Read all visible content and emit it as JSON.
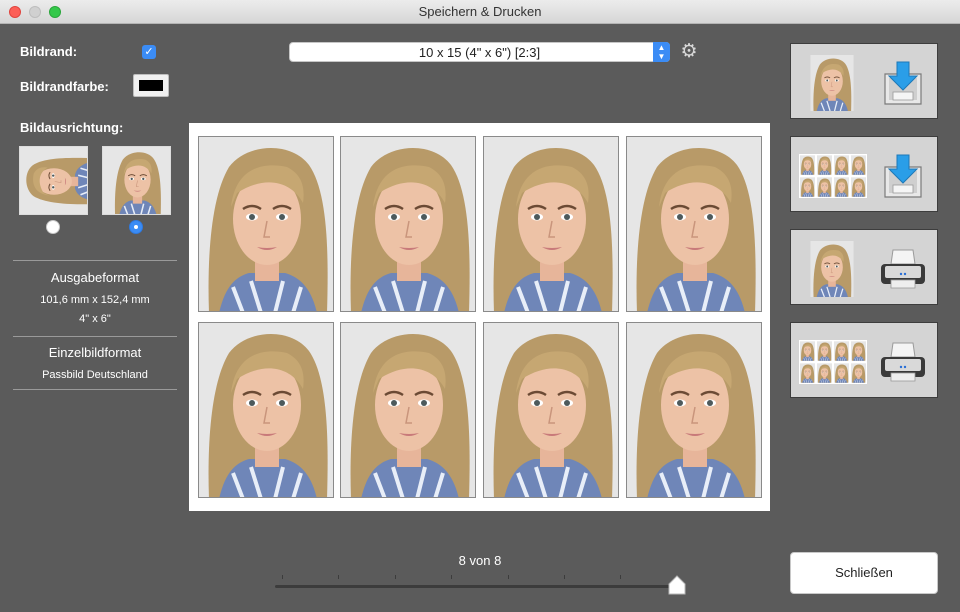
{
  "window": {
    "title": "Speichern & Drucken"
  },
  "left_panel": {
    "border_label": "Bildrand:",
    "border_checked": true,
    "border_color_label": "Bildrandfarbe:",
    "border_color": "#000000",
    "orientation_label": "Bildausrichtung:",
    "orientation_selected": "portrait",
    "output_format": {
      "heading": "Ausgabeformat",
      "size_mm": "101,6 mm x 152,4 mm",
      "size_in": "4\" x 6\""
    },
    "single_format": {
      "heading": "Einzelbildformat",
      "value": "Passbild Deutschland"
    }
  },
  "toolbar": {
    "format_select": "10 x 15 (4\" x 6\") [2:3]",
    "settings_icon": "gear-icon"
  },
  "sheet": {
    "photo_count": 8
  },
  "actions": [
    {
      "name": "save-single-button",
      "icon": "download-icon"
    },
    {
      "name": "save-sheet-button",
      "icon": "download-icon"
    },
    {
      "name": "print-single-button",
      "icon": "printer-icon"
    },
    {
      "name": "print-sheet-button",
      "icon": "printer-icon"
    }
  ],
  "pager": {
    "count_label": "8 von 8",
    "current": 8,
    "total": 8
  },
  "footer": {
    "close_label": "Schließen"
  },
  "colors": {
    "background": "#5b5b5b",
    "accent": "#3b8cf5",
    "action_bg": "#d4d4d4"
  }
}
